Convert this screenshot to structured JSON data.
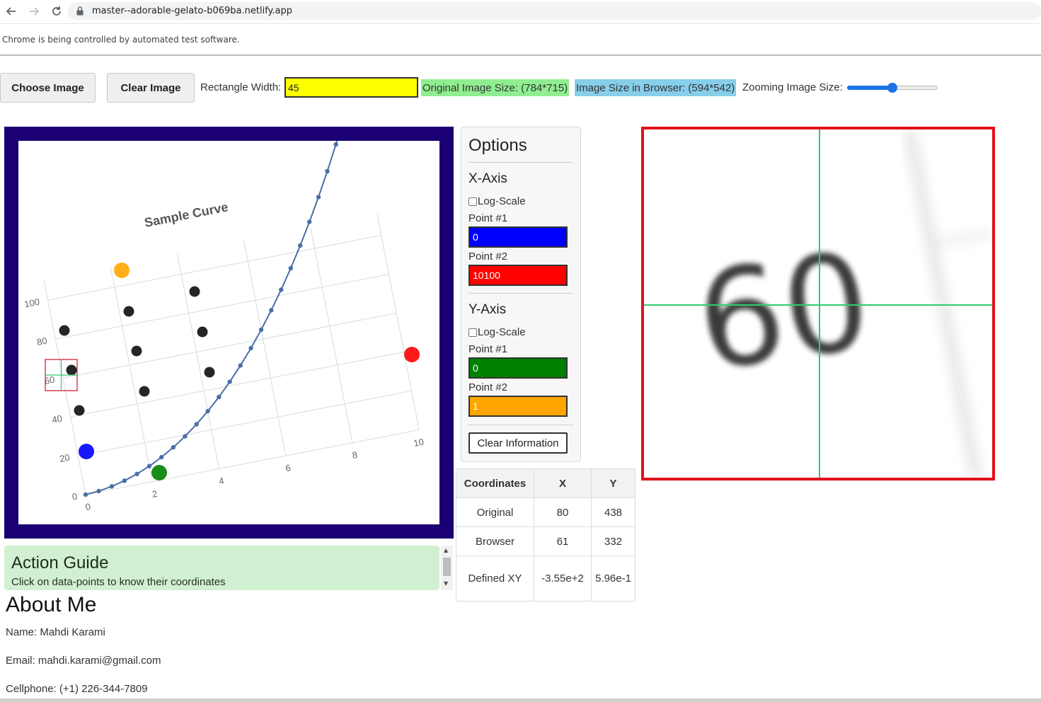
{
  "browser": {
    "url": "master--adorable-gelato-b069ba.netlify.app",
    "automation_notice": "Chrome is being controlled by automated test software."
  },
  "toolbar": {
    "choose_label": "Choose Image",
    "clear_label": "Clear Image",
    "rect_width_label": "Rectangle Width:",
    "rect_width_value": "45",
    "original_size": "Original Image Size: (784*715)",
    "browser_size": "Image Size in Browser: (594*542)",
    "zoom_label": "Zooming Image Size:",
    "zoom_fraction": 0.5
  },
  "plot_image": {
    "title": "Sample Curve",
    "y_ticks": [
      "100",
      "80",
      "60",
      "40",
      "20",
      "0"
    ],
    "x_ticks": [
      "0",
      "2",
      "4",
      "6",
      "8",
      "10"
    ]
  },
  "options": {
    "title": "Options",
    "x_axis": {
      "heading": "X-Axis",
      "log_label": "Log-Scale",
      "log_checked": false,
      "p1_label": "Point #1",
      "p1_value": "0",
      "p1_color": "#0000ff",
      "p2_label": "Point #2",
      "p2_value": "10100",
      "p2_color": "#ff0000"
    },
    "y_axis": {
      "heading": "Y-Axis",
      "log_label": "Log-Scale",
      "log_checked": false,
      "p1_label": "Point #1",
      "p1_value": "0",
      "p1_color": "#008000",
      "p2_label": "Point #2",
      "p2_value": "1",
      "p2_color": "#ffa500"
    },
    "clear_label": "Clear Information"
  },
  "coords_table": {
    "headers": [
      "Coordinates",
      "X",
      "Y"
    ],
    "rows": [
      {
        "label": "Original",
        "x": "80",
        "y": "438"
      },
      {
        "label": "Browser",
        "x": "61",
        "y": "332"
      },
      {
        "label": "Defined XY",
        "x": "-3.55e+2",
        "y": "5.96e-1"
      }
    ]
  },
  "zoom_view": {
    "label_text": "60"
  },
  "guide": {
    "title": "Action Guide",
    "text": "Click on data-points to know their coordinates"
  },
  "about": {
    "title": "About Me",
    "name": "Name: Mahdi Karami",
    "email": "Email: mahdi.karami@gmail.com",
    "phone": "Cellphone: (+1) 226-344-7809"
  },
  "colors": {
    "frame": "#1a0072",
    "zoom_border": "#e3101c",
    "crosshair": "#2ecc71",
    "rect_input": "#ffff00",
    "original_badge": "#90ee90",
    "browser_badge": "#87ceeb",
    "curve": "#4a6fa5"
  }
}
